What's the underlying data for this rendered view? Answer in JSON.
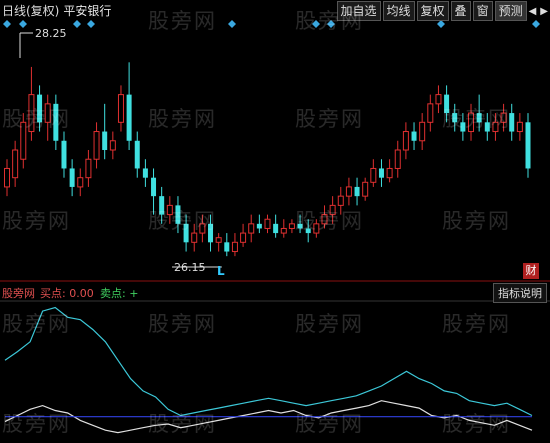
{
  "title": {
    "period": "日线(复权)",
    "stock": "平安银行"
  },
  "toolbar": {
    "buttons": [
      "加自选",
      "均线",
      "复权",
      "叠",
      "窗",
      "预测"
    ],
    "arrow_left": "◀",
    "arrow_right": "▶"
  },
  "price_labels": {
    "high": "28.25",
    "low": "26.15"
  },
  "l_marker": "L",
  "indicator": {
    "name": "股旁网",
    "buy_label": "买点: 0.00",
    "sell_label": "卖点: +",
    "help_button": "指标说明"
  },
  "cai_badge": "财",
  "watermark": "股旁网",
  "colors": {
    "up": "#e03030",
    "down": "#40e0e0",
    "diamond": "#3aa8e0",
    "divider": "#8a1010",
    "cyan_line": "#3cc8d8",
    "white_line": "#e0e0e0",
    "blue_line": "#3040e0"
  },
  "chart_data": [
    {
      "type": "candlestick",
      "title": "日线(复权) 平安银行",
      "high_label": 28.25,
      "low_label": 26.15,
      "candles": [
        [
          26.9,
          27.1,
          26.8,
          27.2
        ],
        [
          27.0,
          27.3,
          26.9,
          27.4
        ],
        [
          27.2,
          27.6,
          27.1,
          27.7
        ],
        [
          27.5,
          27.9,
          27.4,
          28.2
        ],
        [
          27.9,
          27.6,
          27.5,
          28.0
        ],
        [
          27.6,
          27.8,
          27.4,
          27.9
        ],
        [
          27.8,
          27.4,
          27.3,
          27.9
        ],
        [
          27.4,
          27.1,
          27.0,
          27.5
        ],
        [
          27.1,
          26.9,
          26.8,
          27.2
        ],
        [
          26.9,
          27.0,
          26.8,
          27.1
        ],
        [
          27.0,
          27.2,
          26.9,
          27.3
        ],
        [
          27.2,
          27.5,
          27.1,
          27.6
        ],
        [
          27.5,
          27.3,
          27.2,
          27.8
        ],
        [
          27.3,
          27.4,
          27.2,
          27.5
        ],
        [
          27.6,
          27.9,
          27.5,
          28.0
        ],
        [
          27.9,
          27.4,
          27.3,
          28.25
        ],
        [
          27.4,
          27.1,
          27.0,
          27.5
        ],
        [
          27.1,
          27.0,
          26.9,
          27.2
        ],
        [
          27.0,
          26.8,
          26.6,
          27.1
        ],
        [
          26.8,
          26.6,
          26.5,
          26.9
        ],
        [
          26.6,
          26.7,
          26.5,
          26.8
        ],
        [
          26.7,
          26.5,
          26.4,
          26.8
        ],
        [
          26.5,
          26.3,
          26.2,
          26.6
        ],
        [
          26.3,
          26.4,
          26.2,
          26.5
        ],
        [
          26.4,
          26.5,
          26.3,
          26.6
        ],
        [
          26.5,
          26.3,
          26.2,
          26.6
        ],
        [
          26.3,
          26.35,
          26.2,
          26.4
        ],
        [
          26.3,
          26.2,
          26.15,
          26.4
        ],
        [
          26.2,
          26.3,
          26.15,
          26.4
        ],
        [
          26.3,
          26.4,
          26.25,
          26.5
        ],
        [
          26.4,
          26.5,
          26.3,
          26.6
        ],
        [
          26.5,
          26.45,
          26.4,
          26.6
        ],
        [
          26.45,
          26.55,
          26.4,
          26.6
        ],
        [
          26.5,
          26.4,
          26.35,
          26.6
        ],
        [
          26.4,
          26.45,
          26.35,
          26.55
        ],
        [
          26.45,
          26.5,
          26.4,
          26.55
        ],
        [
          26.5,
          26.45,
          26.4,
          26.6
        ],
        [
          26.45,
          26.4,
          26.3,
          26.55
        ],
        [
          26.4,
          26.5,
          26.35,
          26.55
        ],
        [
          26.5,
          26.6,
          26.45,
          26.7
        ],
        [
          26.6,
          26.7,
          26.5,
          26.8
        ],
        [
          26.7,
          26.8,
          26.6,
          26.9
        ],
        [
          26.8,
          26.9,
          26.7,
          27.0
        ],
        [
          26.9,
          26.8,
          26.7,
          27.0
        ],
        [
          26.8,
          26.95,
          26.75,
          27.0
        ],
        [
          26.95,
          27.1,
          26.9,
          27.2
        ],
        [
          27.1,
          27.0,
          26.9,
          27.2
        ],
        [
          27.0,
          27.1,
          26.95,
          27.2
        ],
        [
          27.1,
          27.3,
          27.0,
          27.4
        ],
        [
          27.3,
          27.5,
          27.2,
          27.6
        ],
        [
          27.5,
          27.4,
          27.3,
          27.6
        ],
        [
          27.4,
          27.6,
          27.3,
          27.7
        ],
        [
          27.6,
          27.8,
          27.5,
          27.9
        ],
        [
          27.8,
          27.9,
          27.7,
          28.0
        ],
        [
          27.9,
          27.7,
          27.6,
          28.0
        ],
        [
          27.7,
          27.6,
          27.5,
          27.8
        ],
        [
          27.6,
          27.5,
          27.4,
          27.7
        ],
        [
          27.5,
          27.7,
          27.4,
          27.8
        ],
        [
          27.7,
          27.6,
          27.5,
          27.9
        ],
        [
          27.6,
          27.5,
          27.4,
          27.7
        ],
        [
          27.5,
          27.6,
          27.4,
          27.7
        ],
        [
          27.6,
          27.7,
          27.5,
          27.8
        ],
        [
          27.7,
          27.5,
          27.4,
          27.8
        ],
        [
          27.5,
          27.6,
          27.4,
          27.7
        ],
        [
          27.6,
          27.1,
          27.0,
          27.7
        ]
      ]
    },
    {
      "type": "line",
      "title": "股旁网",
      "series": [
        {
          "values": [
            0.55,
            0.62,
            0.7,
            0.95,
            0.98,
            0.9,
            0.88,
            0.8,
            0.7,
            0.55,
            0.4,
            0.3,
            0.25,
            0.15,
            0.1,
            0.12,
            0.14,
            0.16,
            0.18,
            0.2,
            0.22,
            0.24,
            0.22,
            0.2,
            0.18,
            0.2,
            0.22,
            0.24,
            0.26,
            0.3,
            0.34,
            0.4,
            0.46,
            0.4,
            0.36,
            0.3,
            0.28,
            0.22,
            0.2,
            0.18,
            0.2,
            0.15,
            0.1
          ]
        },
        {
          "values": [
            0.05,
            0.1,
            0.15,
            0.18,
            0.14,
            0.12,
            0.06,
            0.02,
            -0.02,
            -0.04,
            -0.02,
            0.0,
            0.02,
            0.03,
            0.0,
            0.02,
            0.04,
            0.06,
            0.08,
            0.1,
            0.12,
            0.14,
            0.12,
            0.14,
            0.1,
            0.08,
            0.12,
            0.14,
            0.16,
            0.18,
            0.22,
            0.2,
            0.18,
            0.16,
            0.1,
            0.08,
            0.1,
            0.06,
            0.04,
            0.02,
            0.06,
            0.02,
            -0.02
          ]
        },
        {
          "values": [
            0.09,
            0.09,
            0.09,
            0.09,
            0.09,
            0.09,
            0.09,
            0.09,
            0.09,
            0.09,
            0.09,
            0.09,
            0.09,
            0.09,
            0.09,
            0.09,
            0.09,
            0.09,
            0.09,
            0.09,
            0.09,
            0.09,
            0.09,
            0.09,
            0.09,
            0.09,
            0.09,
            0.09,
            0.09,
            0.09,
            0.09,
            0.09,
            0.09,
            0.09,
            0.09,
            0.09,
            0.09,
            0.09,
            0.09,
            0.09,
            0.09,
            0.09,
            0.09
          ]
        }
      ]
    }
  ]
}
